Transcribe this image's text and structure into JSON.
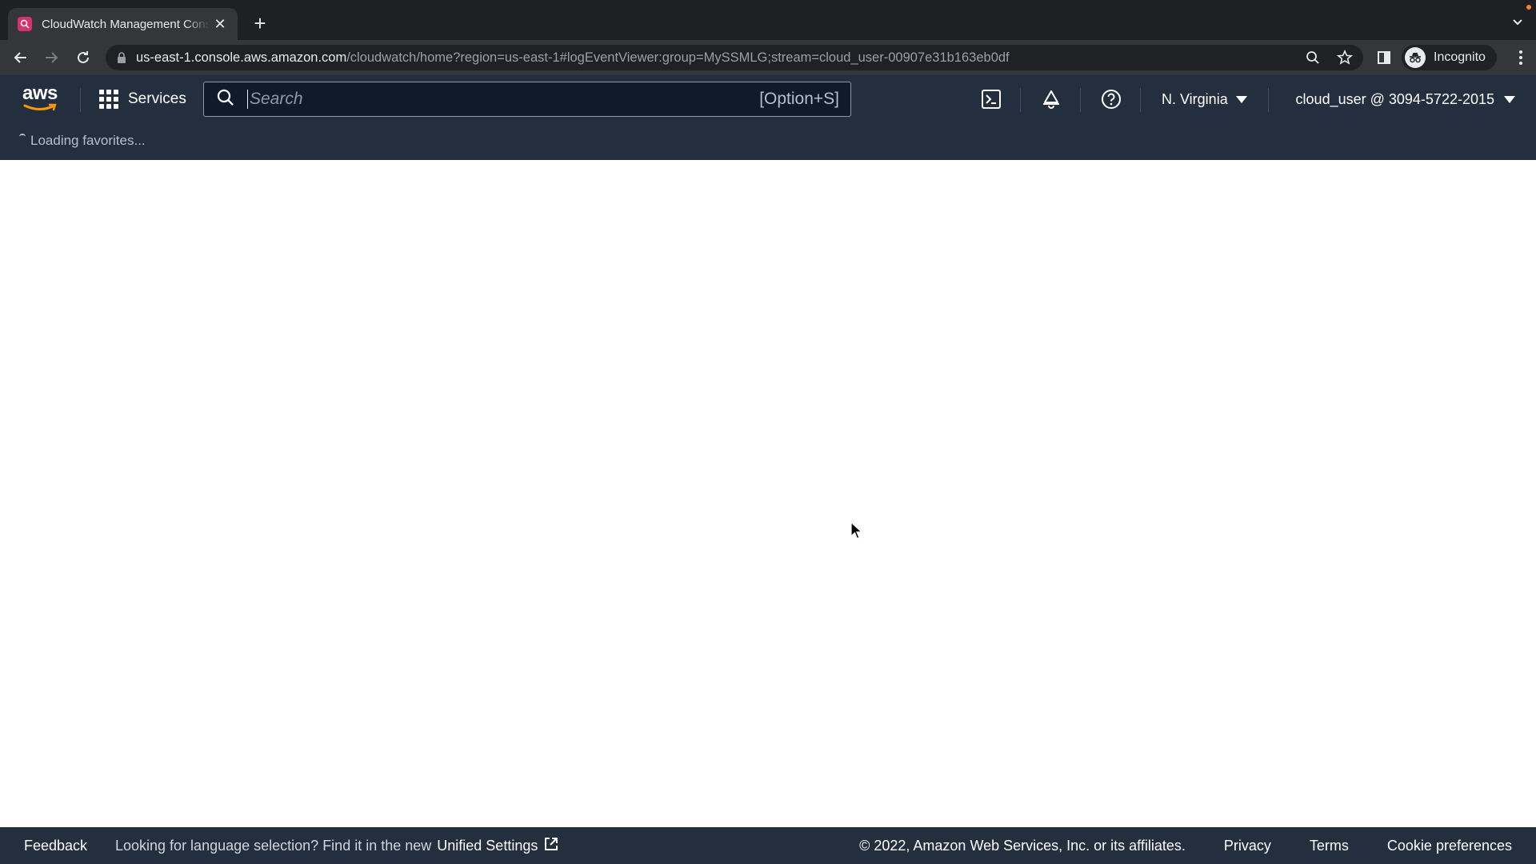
{
  "browser": {
    "tab_title": "CloudWatch Management Console",
    "new_tab_icon": "plus-icon",
    "url_host": "us-east-1.console.aws.amazon.com",
    "url_path": "/cloudwatch/home?region=us-east-1#logEventViewer:group=MySSMLG;stream=cloud_user-00907e31b163eb0df",
    "incognito_label": "Incognito"
  },
  "awsnav": {
    "logo": "aws",
    "services_label": "Services",
    "search_placeholder": "Search",
    "search_shortcut": "[Option+S]",
    "region_label": "N. Virginia",
    "account_label": "cloud_user @ 3094-5722-2015",
    "favorites_status": "Loading favorites..."
  },
  "footer": {
    "feedback": "Feedback",
    "language_prompt": "Looking for language selection? Find it in the new",
    "unified_settings": "Unified Settings",
    "copyright": "© 2022, Amazon Web Services, Inc. or its affiliates.",
    "privacy": "Privacy",
    "terms": "Terms",
    "cookie": "Cookie preferences"
  },
  "colors": {
    "aws_nav_bg": "#232f3e",
    "browser_tabbar_bg": "#1f2023",
    "browser_toolbar_bg": "#35363a",
    "favicon": "#d6336c"
  }
}
